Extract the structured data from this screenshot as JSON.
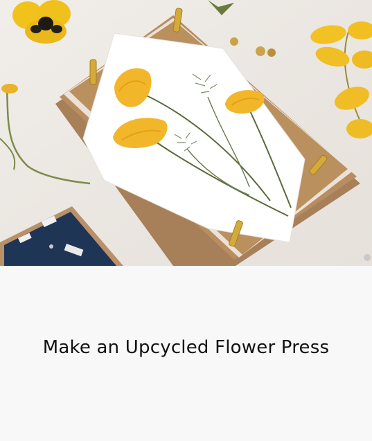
{
  "card": {
    "title": "Make an Upcycled Flower Press",
    "image_alt": "Pressed yellow poppies and fern sprigs on white paper atop a cardboard flower press with brass bolts"
  },
  "colors": {
    "background": "#f8f8f9",
    "title_text": "#111111",
    "petal_yellow": "#f2b62a",
    "cardboard": "#b78c5f"
  }
}
